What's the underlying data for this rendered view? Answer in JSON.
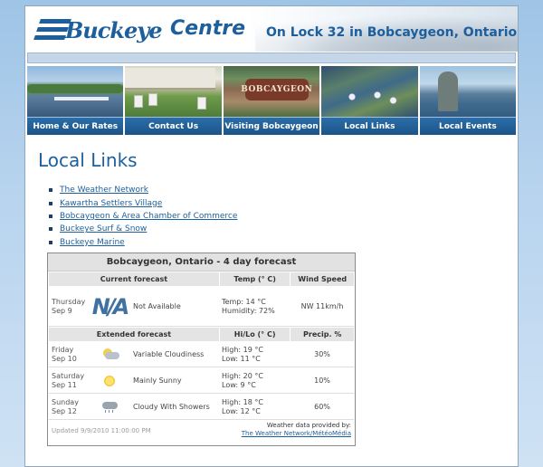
{
  "header": {
    "logo_buckeye": "Buckeye",
    "logo_centre": "Centre",
    "tagline": "On Lock 32 in Bobcaygeon, Ontario"
  },
  "nav": {
    "items": [
      {
        "label": "Home & Our Rates"
      },
      {
        "label": "Contact Us"
      },
      {
        "label": "Visiting Bobcaygeon"
      },
      {
        "label": "Local Links"
      },
      {
        "label": "Local Events"
      }
    ],
    "sign_text": "BOBCAYGEON"
  },
  "main": {
    "title": "Local Links",
    "links": [
      "The Weather Network",
      "Kawartha Settlers Village",
      "Bobcaygeon & Area Chamber of Commerce",
      "Buckeye Surf & Snow",
      "Buckeye Marine"
    ]
  },
  "weather": {
    "title": "Bobcaygeon, Ontario - 4 day forecast",
    "current_header": {
      "forecast": "Current forecast",
      "temp": "Temp (° C)",
      "wind": "Wind Speed"
    },
    "current": {
      "day": "Thursday",
      "date": "Sep 9",
      "icon": "na-icon",
      "icon_text": "N/A",
      "condition": "Not Available",
      "temp_line": "Temp: 14 °C",
      "humidity_line": "Humidity: 72%",
      "wind": "NW 11km/h"
    },
    "extended_header": {
      "forecast": "Extended forecast",
      "hilo": "Hi/Lo (° C)",
      "precip": "Precip. %"
    },
    "extended": [
      {
        "day": "Friday",
        "date": "Sep 10",
        "icon": "cloud-sun-icon",
        "condition": "Variable Cloudiness",
        "high": "High: 19 °C",
        "low": "Low: 11 °C",
        "precip": "30%"
      },
      {
        "day": "Saturday",
        "date": "Sep 11",
        "icon": "sun-icon",
        "condition": "Mainly Sunny",
        "high": "High: 20 °C",
        "low": "Low: 9 °C",
        "precip": "10%"
      },
      {
        "day": "Sunday",
        "date": "Sep 12",
        "icon": "cloud-rain-icon",
        "condition": "Cloudy With Showers",
        "high": "High: 18 °C",
        "low": "Low: 12 °C",
        "precip": "60%"
      }
    ],
    "updated": "Updated 9/9/2010 11:00:00 PM",
    "provided_by": "Weather data provided by:",
    "provider_link": "The Weather Network/MétéoMédia"
  }
}
